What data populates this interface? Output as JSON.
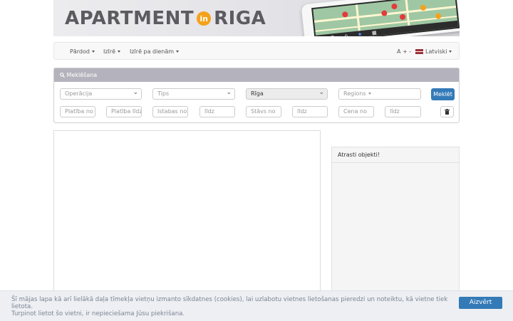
{
  "header": {
    "logo_part1": "APARTMENT",
    "logo_in": "in",
    "logo_part2": "RIGA",
    "colors": {
      "logo_text": "#5b5b60",
      "logo_badge": "#f4a21c"
    }
  },
  "nav": {
    "items": [
      {
        "label": "Pārdod"
      },
      {
        "label": "Izīrē"
      },
      {
        "label": "Izīrē pa dienām"
      }
    ],
    "font_size_control": "A + -",
    "language": "Latviski"
  },
  "search": {
    "panel_title": "Meklēšana",
    "operation_placeholder": "Operācija",
    "type_placeholder": "Tips",
    "city_value": "Rīga",
    "regions_placeholder": "Regions",
    "search_button": "Meklēt",
    "area_from": "Platība no",
    "area_to": "Platība līdz",
    "rooms_from": "Istabas no",
    "rooms_to": "līdz",
    "floor_from": "Stāvs no",
    "floor_to": "līdz",
    "price_from": "Cena no",
    "price_to": "līdz",
    "colors": {
      "panel_head": "#b4b3bd",
      "primary_button": "#337ab7"
    }
  },
  "results": {
    "title": "Atrasti objekti!"
  },
  "cookie": {
    "line1": "Šī mājas lapa kā arī lielākā daļa tīmekļa vietņu izmanto sīkdatnes (cookies), lai uzlabotu vietnes lietošanas pieredzi un noteiktu, kā vietne tiek lietota.",
    "line2": "Turpinot lietot šo vietni, ir nepieciešama Jūsu piekrišana.",
    "agree_button": "Aizvērt"
  }
}
